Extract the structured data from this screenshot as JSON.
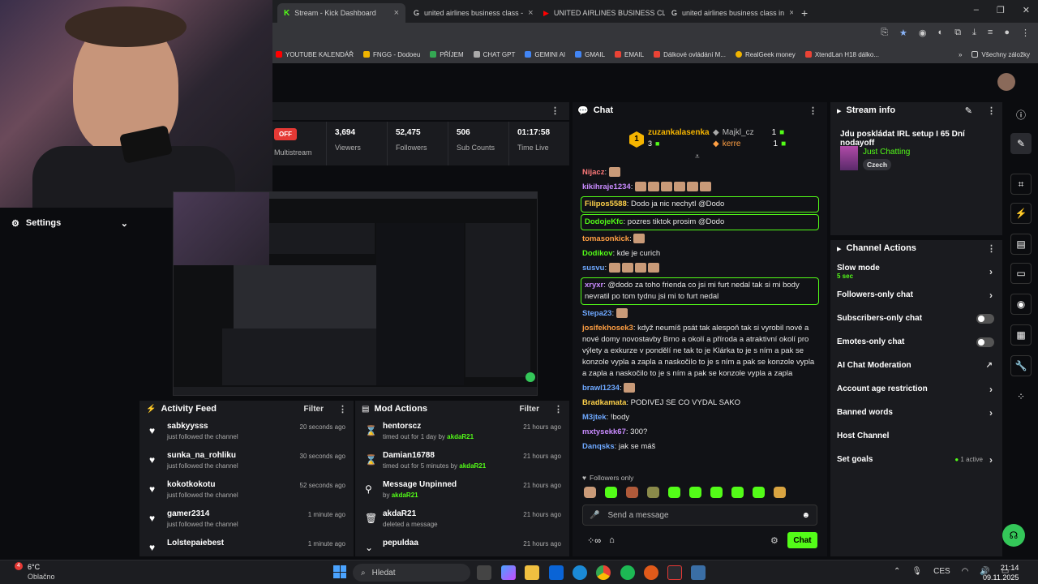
{
  "browser": {
    "tabs": [
      {
        "label": "Stream - Kick Dashboard",
        "active": true
      },
      {
        "label": "united airlines business class - "
      },
      {
        "label": "UNITED AIRLINES BUSINESS CL"
      },
      {
        "label": "united airlines business class in"
      }
    ],
    "new_tab": "+",
    "bookmarks": [
      "YOUTUBE KALENDÁŘ",
      "FNGG - Dodoeu",
      "PŘÍJEM",
      "CHAT GPT",
      "GEMINI AI",
      "GMAIL",
      "EMAIL",
      "Dálkové ovládání M...",
      "RealGeek money",
      "XtendLan H18 dálko..."
    ],
    "all_bookmarks": "Všechny záložky",
    "more": "»"
  },
  "stats": {
    "status": "OFF",
    "items": [
      {
        "value": "",
        "label": "Multistream"
      },
      {
        "value": "3,694",
        "label": "Viewers"
      },
      {
        "value": "52,475",
        "label": "Followers"
      },
      {
        "value": "506",
        "label": "Sub Counts"
      },
      {
        "value": "01:17:58",
        "label": "Time Live"
      }
    ]
  },
  "settings": {
    "label": "Settings"
  },
  "activity": {
    "title": "Activity Feed",
    "filter": "Filter",
    "rows": [
      {
        "name": "sabkyysss",
        "desc": "just followed the channel",
        "time": "20 seconds ago"
      },
      {
        "name": "sunka_na_rohliku",
        "desc": "just followed the channel",
        "time": "30 seconds ago"
      },
      {
        "name": "kokotkokotu",
        "desc": "just followed the channel",
        "time": "52 seconds ago"
      },
      {
        "name": "gamer2314",
        "desc": "just followed the channel",
        "time": "1 minute ago"
      },
      {
        "name": "Lolstepaiebest",
        "desc": "",
        "time": "1 minute ago"
      }
    ]
  },
  "mod": {
    "title": "Mod Actions",
    "filter": "Filter",
    "rows": [
      {
        "name": "hentorscz",
        "desc": "timed out for 1 day by",
        "by": "akdaR21",
        "time": "21 hours ago"
      },
      {
        "name": "Damian16788",
        "desc": "timed out for 5 minutes by",
        "by": "akdaR21",
        "time": "21 hours ago"
      },
      {
        "name": "Message Unpinned",
        "desc": "by",
        "by": "akdaR21",
        "time": "21 hours ago"
      },
      {
        "name": "akdaR21",
        "desc": "deleted a message",
        "by": "",
        "time": "21 hours ago"
      },
      {
        "name": "pepuldaa",
        "desc": "",
        "by": "",
        "time": "21 hours ago"
      }
    ]
  },
  "chat": {
    "title": "Chat",
    "leader1": {
      "name": "zuzankalasenka",
      "count": "3"
    },
    "leader2": {
      "name": "Majkl_cz",
      "count": "1"
    },
    "leader3": {
      "name": "kerre",
      "count": "1"
    },
    "rank": "1",
    "messages": [
      {
        "user": "Nijacz",
        "text": "",
        "color": "#ff7a7a"
      },
      {
        "user": "kikihraje1234",
        "text": "",
        "color": "#c98bff"
      },
      {
        "user": "Filipos5588",
        "text": "Dodo ja nic nechytl @Dodo",
        "color": "#ffd24a",
        "hl": true
      },
      {
        "user": "DodojeKfc",
        "text": "pozres tiktok prosim @Dodo",
        "color": "#53fc18",
        "hl": true
      },
      {
        "user": "tomasonkick",
        "text": "",
        "color": "#ff9f43"
      },
      {
        "user": "Dodikov",
        "text": "kde je curich",
        "color": "#53fc18"
      },
      {
        "user": "susvu",
        "text": "",
        "color": "#6ea8ff"
      },
      {
        "user": "xryxr",
        "text": "@dodo za toho frienda co jsi mi furt nedal tak si mi body nevratil po tom tydnu jsi mi to furt nedal",
        "color": "#c98bff",
        "hl": true
      },
      {
        "user": "Stepa23",
        "text": "",
        "color": "#6ea8ff"
      },
      {
        "user": "josifekhosek3",
        "text": "když neumíš psát tak alespoň tak si vyrobil nové a nové domy novostavby Brno a okolí a příroda a atraktivní okolí pro výlety a exkurze v pondělí ne tak to je Klárka to je s ním a pak se konzole vypla a zapla a naskočilo to je s ním a pak se konzole vypla a zapla a naskočilo to je s ním a pak se konzole vypla a zapla",
        "color": "#ff9f43"
      },
      {
        "user": "brawl1234",
        "text": "",
        "color": "#6ea8ff"
      },
      {
        "user": "Bradkamata",
        "text": "PODIVEJ SE CO VYDAL SAKO",
        "color": "#ffd24a"
      },
      {
        "user": "M3jtek",
        "text": "!body",
        "color": "#6ea8ff"
      },
      {
        "user": "mxtysekk67",
        "text": "300?",
        "color": "#c98bff"
      },
      {
        "user": "Danqsks",
        "text": "jak se máš",
        "color": "#6ea8ff"
      }
    ],
    "followers_only": "Followers only",
    "input_placeholder": "Send a message",
    "send": "Chat"
  },
  "stream_info": {
    "title": "Stream info",
    "stream_title": "Jdu poskládat IRL setup I 65 Dní nodayoff",
    "category": "Just Chatting",
    "language": "Czech"
  },
  "channel_actions": {
    "title": "Channel Actions",
    "items": [
      {
        "label": "Slow mode",
        "sub": "5 sec",
        "type": "arrow"
      },
      {
        "label": "Followers-only chat",
        "sub": "",
        "type": "arrow"
      },
      {
        "label": "Subscribers-only chat",
        "sub": "",
        "type": "toggle"
      },
      {
        "label": "Emotes-only chat",
        "sub": "",
        "type": "toggle"
      },
      {
        "label": "AI Chat Moderation",
        "sub": "",
        "type": "link"
      },
      {
        "label": "Account age restriction",
        "sub": "",
        "type": "arrow"
      },
      {
        "label": "Banned words",
        "sub": "",
        "type": "arrow"
      },
      {
        "label": "Host Channel",
        "sub": "",
        "type": "none"
      },
      {
        "label": "Set goals",
        "sub": "1 active",
        "type": "arrow"
      }
    ]
  },
  "taskbar": {
    "weather_temp": "6°C",
    "weather_desc": "Oblačno",
    "search": "Hledat",
    "lang": "CES",
    "time": "21:14",
    "date": "09.11.2025",
    "badge": "4"
  },
  "colors": {
    "accent": "#53fc18",
    "panel": "#1a1b1f",
    "bg": "#0b0c0f"
  }
}
